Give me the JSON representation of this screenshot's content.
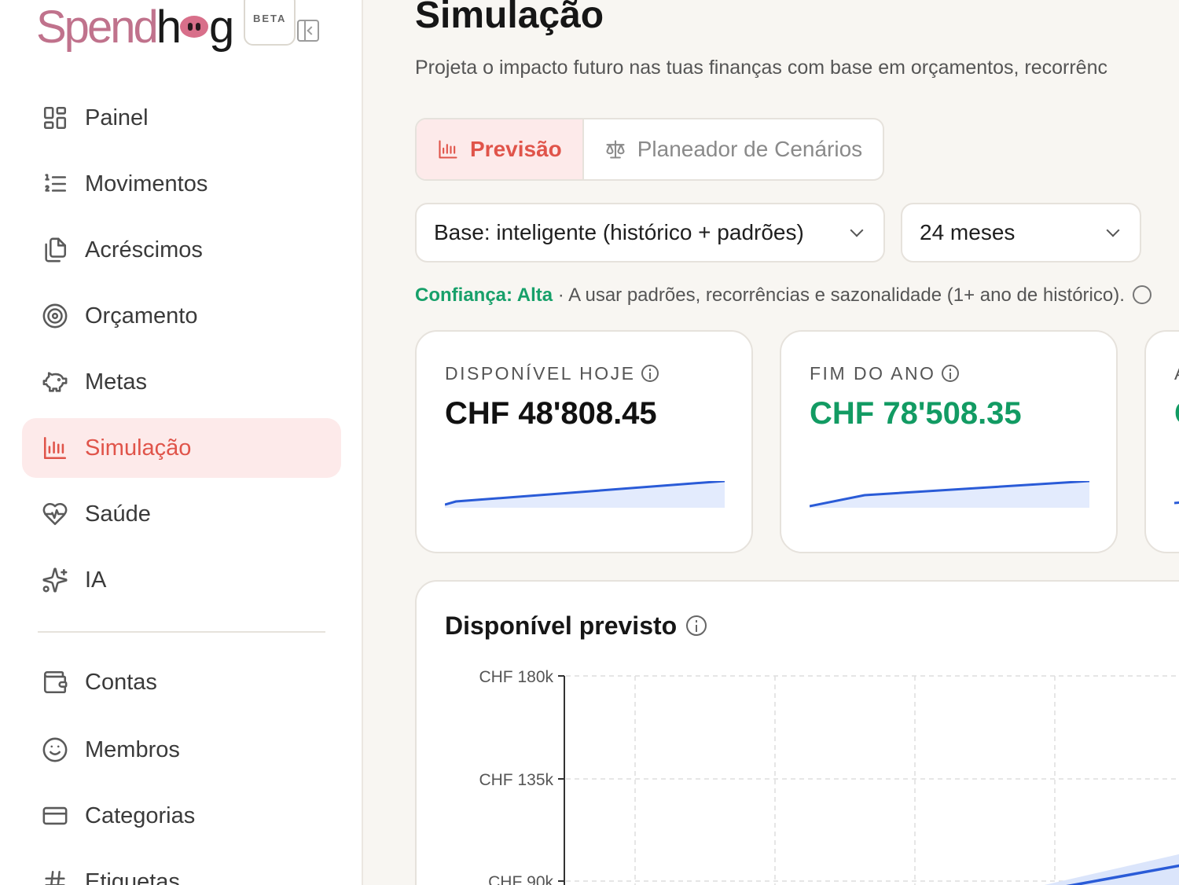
{
  "brand": {
    "name_a": "Spend",
    "name_b": "h",
    "name_c": "g",
    "badge": "BETA"
  },
  "sidebar": {
    "items": [
      {
        "label": "Painel",
        "icon": "grid-icon"
      },
      {
        "label": "Movimentos",
        "icon": "list-ordered-icon"
      },
      {
        "label": "Acréscimos",
        "icon": "files-icon"
      },
      {
        "label": "Orçamento",
        "icon": "target-icon"
      },
      {
        "label": "Metas",
        "icon": "piggy-bank-icon"
      },
      {
        "label": "Simulação",
        "icon": "bar-chart-icon",
        "active": true
      },
      {
        "label": "Saúde",
        "icon": "heart-pulse-icon"
      },
      {
        "label": "IA",
        "icon": "sparkles-icon"
      }
    ],
    "secondary": [
      {
        "label": "Contas",
        "icon": "wallet-icon"
      },
      {
        "label": "Membros",
        "icon": "smile-icon"
      },
      {
        "label": "Categorias",
        "icon": "card-icon"
      },
      {
        "label": "Etiquetas",
        "icon": "hash-icon"
      }
    ]
  },
  "page": {
    "title": "Simulação",
    "subtitle": "Projeta o impacto futuro nas tuas finanças com base em orçamentos, recorrênc"
  },
  "tabs": [
    {
      "label": "Previsão",
      "active": true
    },
    {
      "label": "Planeador de Cenários",
      "active": false
    }
  ],
  "filters": {
    "base": "Base: inteligente (histórico + padrões)",
    "period": "24 meses"
  },
  "confidence": {
    "label": "Confiança: Alta",
    "text": " · A usar padrões, recorrências e sazonalidade (1+ ano de histórico)."
  },
  "cards": [
    {
      "label": "DISPONÍVEL HOJE",
      "value": "CHF 48'808.45"
    },
    {
      "label": "FIM DO ANO",
      "value": "CHF 78'508.35"
    },
    {
      "label": "A",
      "value": "C"
    }
  ],
  "colors": {
    "accent": "#e0544a",
    "positive": "#129b63",
    "line": "#2a5bd7",
    "active_bg": "#fdeaea"
  },
  "chart_data": {
    "type": "area",
    "title": "Disponível previsto",
    "y_ticks": [
      "CHF 180k",
      "CHF 135k",
      "CHF 90k"
    ],
    "ylim": [
      90000,
      180000
    ],
    "grid": true,
    "series": [
      {
        "values": [
          48808,
          78508,
          90000
        ]
      }
    ]
  }
}
